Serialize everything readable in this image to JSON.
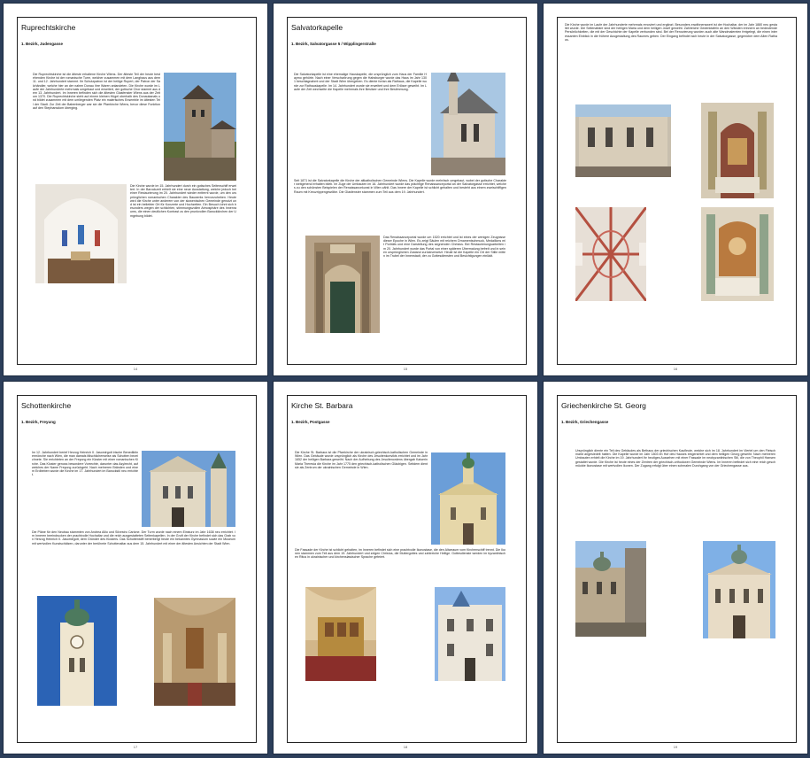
{
  "pages": [
    {
      "title": "Ruprechtskirche",
      "subtitle": "1. Bezirk, Judengasse",
      "page_number": "14",
      "body_1": "Die Ruprechtskirche ist die älteste erhaltene Kirche Wiens. Der älteste Teil der heute bestehenden Kirche ist der romanische Turm, welcher zusammen mit dem Langhaus aus dem 11. und 12. Jahrhundert stammt. Ihr Schutzpatron ist der heilige Rupert, der Patron der Salzhändler, welche hier an der nahen Donau ihre Waren anlandeten. Die Kirche wurde im Laufe der Jahrhunderte mehrmals umgebaut und erweitert, der gotische Chor stammt aus dem 13. Jahrhundert. Im Inneren befinden sich die ältesten Glasfenster Wiens aus der Zeit um 1370. Die Ruprechtskirche steht auf einem kleinen Hügel oberhalb des Donaukanals und bildet zusammen mit dem umliegenden Platz ein malerisches Ensemble im ältesten Teil der Stadt. Zur Zeit der Babenberger war sie die Pfarrkirche Wiens, bevor diese Funktion auf den Stephansdom überging.",
      "body_2": "Die Kirche wurde im 15. Jahrhundert durch ein gotisches Seitenschiff erweitert. In der Barockzeit erhielt sie eine neue Ausstattung, welche jedoch bei einer Restaurierung im 20. Jahrhundert wieder entfernt wurde, um den ursprünglichen romanischen Charakter des Bauwerks hervorzuheben. Heute wird die Kirche unter anderem von der slowenischen Gemeinde genutzt und ist ein beliebter Ort für Konzerte und Hochzeiten. Ein Besuch lohnt sich besonders wegen der schlichten, stimmungsvollen Atmosphäre des Innenraums, die einen deutlichen Kontrast zu den prunkvollen Barockkirchen der Umgebung bildet."
    },
    {
      "title": "Salvatorkapelle",
      "subtitle": "1. Bezirk, Salvatorgasse 5 / Wipplingerstraße",
      "page_number": "15",
      "body_1": "Die Salvatorkapelle ist eine ehemalige Hauskapelle, die ursprünglich zum Haus der Familie Haymo gehörte. Nach einer Verschwörung gegen die Habsburger wurde das Haus im Jahr 1301 beschlagnahmt und der Stadt Wien übergeben. Es diente fortan als Rathaus, die Kapelle wurde zur Rathauskapelle. Im 14. Jahrhundert wurde sie erweitert und dem Erlöser geweiht. Im Laufe der Zeit wechselte die Kapelle mehrmals ihre Besitzer und ihre Bestimmung.",
      "body_2": "Seit 1871 ist die Salvatorkapelle die Kirche der altkatholischen Gemeinde Wiens. Die Kapelle wurde mehrfach umgebaut, wobei der gotische Charakter weitgehend erhalten blieb. Im Zuge der Umbauten im 16. Jahrhundert wurde das prächtige Renaissanceportal an der Salvatorgasse errichtet, welches zu den schönsten Beispielen der Renaissancekunst in Wien zählt. Das Innere der Kapelle ist schlicht gehalten und besteht aus einem zweischiffigen Raum mit Kreuzrippengewölbe. Die Glasfenster stammen zum Teil aus dem 19. Jahrhundert.",
      "body_3": "Das Renaissanceportal wurde um 1520 errichtet und ist eines der wenigen Zeugnisse dieser Epoche in Wien. Es zeigt Säulen mit reichem Ornamentschmuck, Medaillons mit Porträts und eine Darstellung des segnenden Christus. Bei Restaurierungsarbeiten im 20. Jahrhundert wurde das Portal von einer späteren Übermalung befreit und in seinen ursprünglichen Zustand zurückversetzt. Heute ist die Kapelle ein Ort der Stille mitten im Trubel der Innenstadt, der zu Gottesdiensten und Besichtigungen einlädt."
    },
    {
      "title": "",
      "subtitle": "",
      "page_number": "16",
      "body_1": "Die Kirche wurde im Laufe der Jahrhunderte mehrmals renoviert und ergänzt. Besonders erwähnenswert ist der Hochaltar, der im Jahr 1880 neu gestaltet wurde. Die Seitenaltäre sind der heiligen Maria und dem heiligen Josef geweiht. Zahlreiche Gedenktafeln an den Wänden erinnern an bedeutende Persönlichkeiten, die mit der Geschichte der Kapelle verbunden sind. Bei der Renovierung wurden auch alte Wandmalereien freigelegt, die einen interessanten Einblick in die frühere Ausgestaltung des Raumes geben. Der Eingang befindet sich heute in der Salvatorgasse, gegenüber dem Alten Rathaus."
    },
    {
      "title": "Schottenkirche",
      "subtitle": "1. Bezirk, Freyung",
      "page_number": "17",
      "body_1": "Im 12. Jahrhundert berief Herzog Heinrich II. Jasomirgott irische Benediktinermönche nach Wien, die man damals fälschlicherweise als Schotten bezeichnete. Sie errichteten an der Freyung ein Kloster mit einer romanischen Kirche. Das Kloster genoss besondere Vorrechte, darunter das Asylrecht, auf welches der Name Freyung zurückgeht. Nach mehreren Bränden und einem Erdbeben wurde die Kirche im 17. Jahrhundert im Barockstil neu errichtet.",
      "body_2": "Die Pläne für den Neubau stammten von Andrea Allio und Silvestro Carlone. Der Turm wurde nach einem Einsturz im Jahr 1638 neu errichtet. Im Inneren beeindrucken der prachtvolle Hochaltar und die reich ausgestatteten Seitenkapellen. In der Gruft der Kirche befindet sich das Grab von Herzog Heinrich II. Jasomirgott, dem Gründer des Klosters. Das Schottenstift beherbergt heute ein bekanntes Gymnasium sowie ein Museum mit wertvollen Kunstschätzen, darunter der berühmte Schottenaltar aus dem 15. Jahrhundert mit einer der ältesten Ansichten der Stadt Wien."
    },
    {
      "title": "Kirche St. Barbara",
      "subtitle": "1. Bezirk, Postgasse",
      "page_number": "18",
      "body_1": "Die Kirche St. Barbara ist die Pfarrkirche der ukrainisch-griechisch-katholischen Gemeinde in Wien. Das Gebäude wurde ursprünglich als Kirche des Jesuitenkonvikts errichtet und im Jahr 1652 der heiligen Barbara geweiht. Nach der Aufhebung des Jesuitenordens übergab Kaiserin Maria Theresia die Kirche im Jahr 1775 den griechisch-katholischen Gläubigen. Seitdem dient sie als Zentrum der ukrainischen Gemeinde in Wien.",
      "body_2": "Die Fassade der Kirche ist schlicht gehalten, im Inneren befindet sich eine prachtvolle Ikonostase, die den Altarraum vom Kirchenschiff trennt. Die Ikonen stammen zum Teil aus dem 19. Jahrhundert und zeigen Christus, die Muttergottes und zahlreiche Heilige. Gottesdienste werden im byzantinischen Ritus in ukrainischer und kirchenslawischer Sprache gefeiert."
    },
    {
      "title": "Griechenkirche St. Georg",
      "subtitle": "1. Bezirk, Griechengasse",
      "page_number": "19",
      "body_1": "Ursprünglich diente ein Teil des Gebäudes als Bethaus der griechischen Kaufleute, welche sich im 18. Jahrhundert im Viertel um den Fleischmarkt angesiedelt hatten. Die Kapelle wurde im Jahr 1803 im Hof des Hauses eingerichtet und dem heiligen Georg geweiht. Nach mehreren Umbauten erhielt die Kirche im 19. Jahrhundert ihr heutiges Aussehen mit einer Fassade im neobyzantinischen Stil, die von Theophil Hansen gestaltet wurde. Die Kirche ist heute eines der Zentren der griechisch-orthodoxen Gemeinde Wiens. Im Inneren befindet sich eine reich geschmückte Ikonostase mit wertvollen Ikonen. Der Zugang erfolgt über einen schmalen Durchgang von der Griechengasse aus."
    }
  ]
}
